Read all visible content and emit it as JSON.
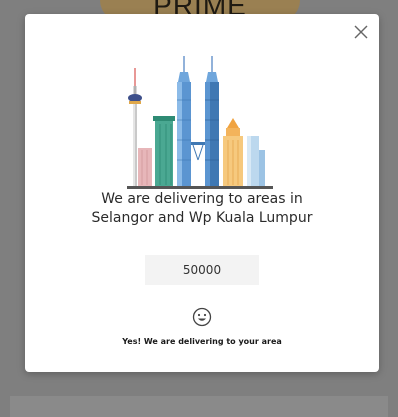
{
  "backdrop": {
    "banner_text": "PRIME",
    "banner_color": "#9a8052"
  },
  "modal": {
    "close_icon": "close-icon",
    "illustration": "kuala-lumpur-skyline",
    "heading_line1": "We are delivering to areas in",
    "heading_line2": "Selangor and Wp Kuala Lumpur",
    "postcode_value": "50000",
    "status_icon": "smiley-icon",
    "status_text": "Yes! We are delivering to your area"
  },
  "colors": {
    "overlay": "#7f7f7f",
    "modal_bg": "#ffffff",
    "input_bg": "#f3f3f3"
  }
}
